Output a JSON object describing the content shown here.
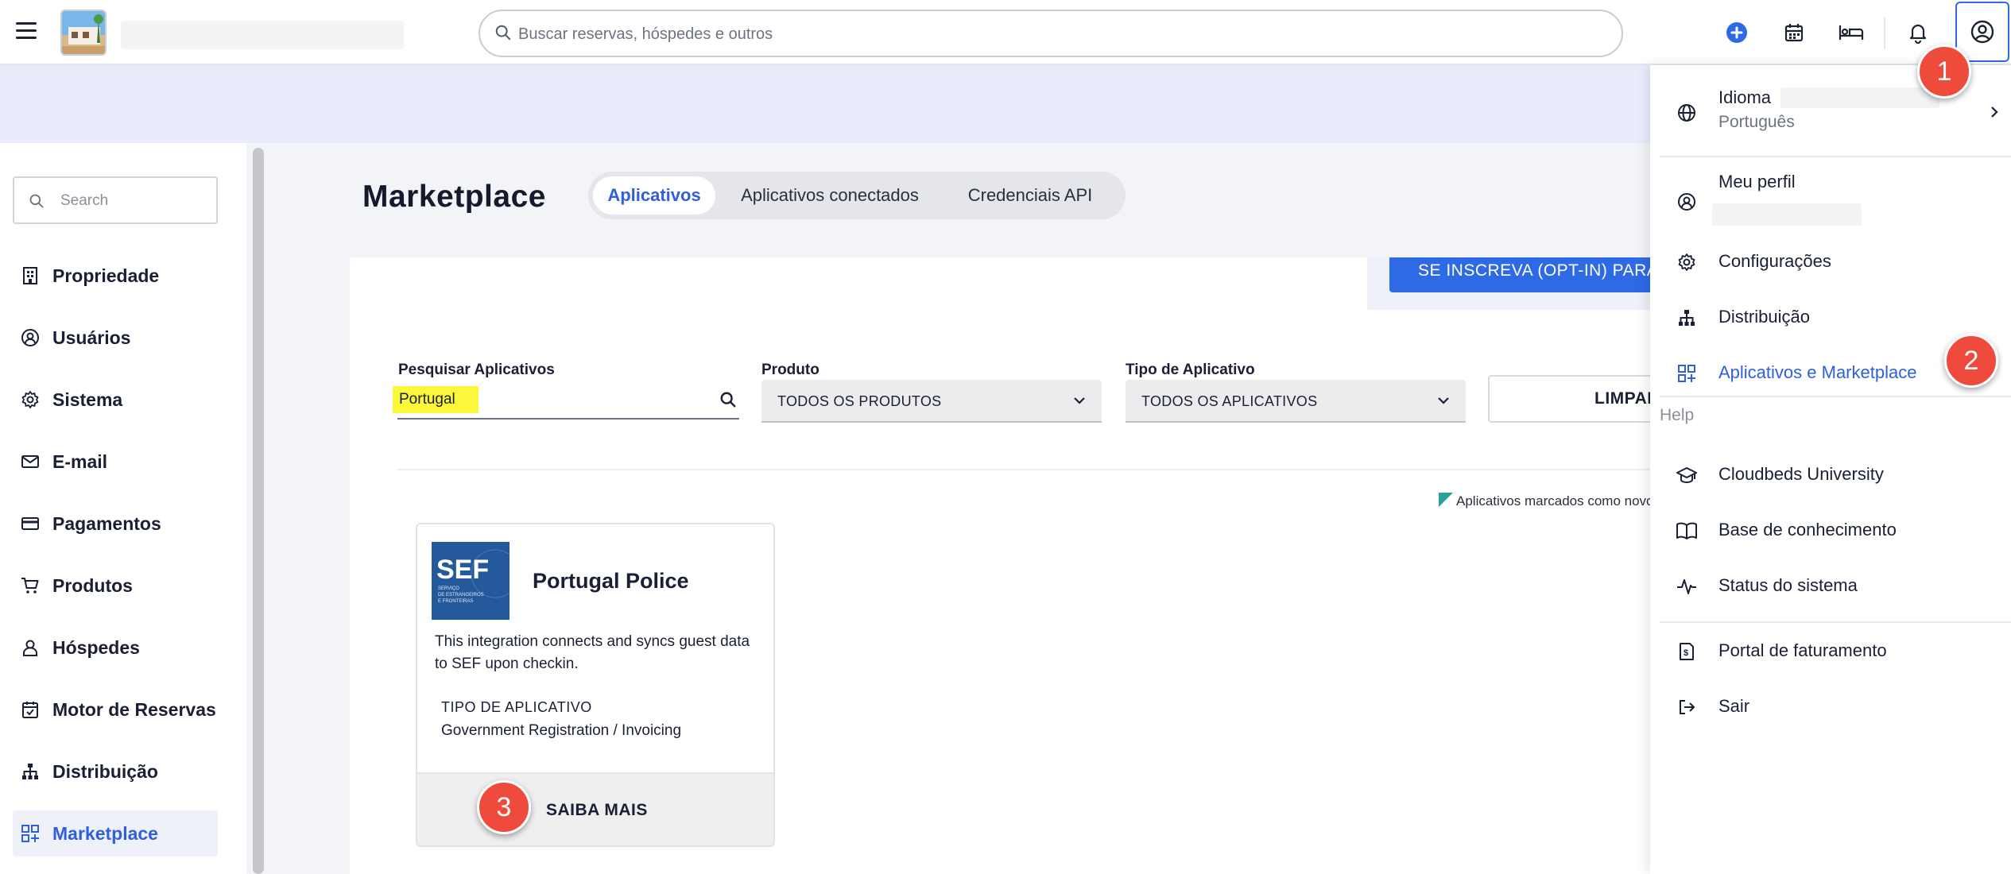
{
  "topbar": {
    "search_placeholder": "Buscar reservas, hóspedes e outros",
    "icons": [
      "menu-icon",
      "add-circle-icon",
      "calendar-icon",
      "bed-icon",
      "bell-icon",
      "account-circle-icon"
    ]
  },
  "sidebar": {
    "search_placeholder": "Search",
    "items": [
      {
        "label": "Propriedade",
        "icon": "building-icon"
      },
      {
        "label": "Usuários",
        "icon": "user-circle-icon"
      },
      {
        "label": "Sistema",
        "icon": "gear-icon"
      },
      {
        "label": "E-mail",
        "icon": "mail-icon"
      },
      {
        "label": "Pagamentos",
        "icon": "credit-card-icon"
      },
      {
        "label": "Produtos",
        "icon": "cart-icon"
      },
      {
        "label": "Hóspedes",
        "icon": "person-icon"
      },
      {
        "label": "Motor de Reservas",
        "icon": "calendar-check-icon"
      },
      {
        "label": "Distribuição",
        "icon": "hierarchy-icon"
      },
      {
        "label": "Marketplace",
        "icon": "apps-add-icon",
        "active": true
      }
    ]
  },
  "main": {
    "title": "Marketplace",
    "tabs": [
      {
        "label": "Aplicativos",
        "active": true
      },
      {
        "label": "Aplicativos conectados"
      },
      {
        "label": "Credenciais API"
      }
    ],
    "optin_button": "SE INSCREVA (OPT-IN) PARA",
    "filters": {
      "search_label": "Pesquisar Aplicativos",
      "search_value": "Portugal",
      "product_label": "Produto",
      "product_value": "TODOS OS PRODUTOS",
      "type_label": "Tipo de Aplicativo",
      "type_value": "TODOS OS APLICATIVOS",
      "clear_button": "LIMPAR"
    },
    "new_note": "Aplicativos marcados como novo",
    "cards": [
      {
        "logo_text": "SEF",
        "logo_subtext": "SERVIÇO DE ESTRANGEIROS E FRONTEIRAS",
        "title": "Portugal Police",
        "description": "This integration connects and syncs guest data to SEF upon checkin.",
        "type_heading": "TIPO DE APLICATIVO",
        "type_value": "Government Registration / Invoicing",
        "action": "SAIBA MAIS"
      }
    ]
  },
  "dropdown": {
    "language_label": "Idioma",
    "language_value": "Português",
    "profile_label": "Meu perfil",
    "settings_label": "Configurações",
    "distribution_label": "Distribuição",
    "marketplace_label": "Aplicativos e Marketplace",
    "help_heading": "Help",
    "university_label": "Cloudbeds University",
    "knowledge_label": "Base de conhecimento",
    "status_label": "Status do sistema",
    "billing_label": "Portal de faturamento",
    "logout_label": "Sair"
  },
  "steps": [
    "1",
    "2",
    "3"
  ],
  "colors": {
    "accent": "#2f6ae6",
    "active_text": "#2f5fe0",
    "banner": "#e9edfb",
    "step_marker": "#ee4b3c",
    "highlight": "#fbf73a",
    "new_marker": "#2aa198"
  }
}
